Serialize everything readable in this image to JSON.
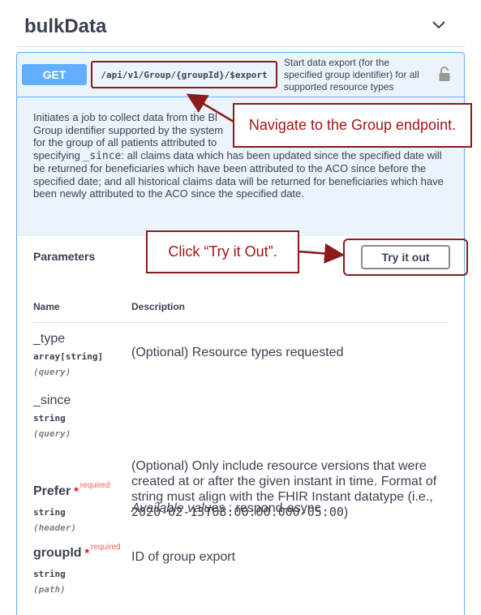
{
  "section": {
    "title": "bulkData"
  },
  "operation": {
    "method": "GET",
    "path": "/api/v1/Group/{groupId}/$export",
    "summary": "Start data export (for the specified group identifier) for all supported resource types",
    "description_lines": [
      "Initiates a job to collect data from the Bl",
      "Group identifier supported by the system",
      "for the group of all patients attributed to"
    ],
    "description_since_pre": "specifying ",
    "description_since_code": "_since",
    "description_tail": ": all claims data which has been updated since the specified date will be returned for beneficiaries which have been attributed to the ACO since before the specified date; and all historical claims data will be returned for beneficiaries which have been newly attributed to the ACO since the specified date."
  },
  "parameters": {
    "label": "Parameters",
    "try_button": "Try it out",
    "col_name": "Name",
    "col_description": "Description",
    "items": [
      {
        "name": "_type",
        "type": "array[string]",
        "in": "(query)",
        "description": "(Optional) Resource types requested"
      },
      {
        "name": "_since",
        "type": "string",
        "in": "(query)",
        "description": "(Optional) Only include resource versions that were created at or after the given instant in time. Format of string must align with the FHIR Instant datatype (i.e.,",
        "description_code": "2020-02-13T08:00:00.000-05:00",
        "description_close": ")"
      },
      {
        "name": "Prefer",
        "required_star": "*",
        "required_label": "required",
        "type": "string",
        "in": "(header)",
        "desc_label": "Available values",
        "desc_value": " : respond-async"
      },
      {
        "name": "groupId",
        "required_star": "*",
        "required_label": "required",
        "type": "string",
        "in": "(path)",
        "description": "ID of group export"
      }
    ]
  },
  "annotations": {
    "navigate": "Navigate to the Group endpoint.",
    "try": "Click “Try it Out”."
  },
  "colors": {
    "get": "#61affe",
    "annotation": "#8b1a1a",
    "required": "#ff0000"
  },
  "icons": {
    "collapse": "chevron-down-icon",
    "lock": "lock-icon"
  }
}
